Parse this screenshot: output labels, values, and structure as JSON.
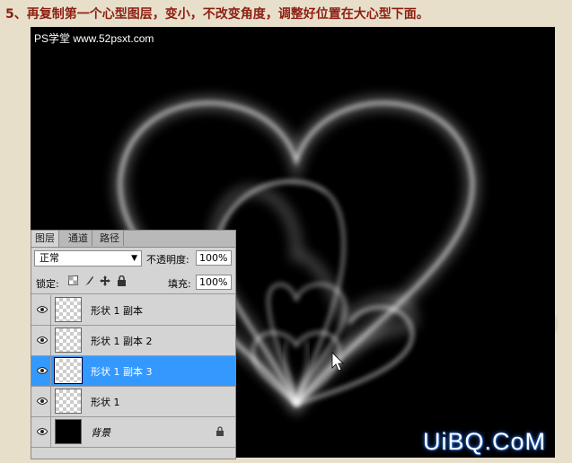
{
  "caption": "5、再复制第一个心型图层，变小，不改变角度，调整好位置在大心型下面。",
  "watermark_top": "PS学堂 www.52psxt.com",
  "watermark_bottom": "UiBQ.CoM",
  "panel": {
    "tabs": [
      "图层",
      "通道",
      "路径"
    ],
    "blend_mode": "正常",
    "opacity_label": "不透明度:",
    "opacity_value": "100%",
    "lock_label": "锁定:",
    "fill_label": "填充:",
    "fill_value": "100%",
    "layers": [
      {
        "name": "形状 1 副本",
        "selected": false
      },
      {
        "name": "形状 1 副本 2",
        "selected": false
      },
      {
        "name": "形状 1 副本 3",
        "selected": true
      },
      {
        "name": "形状 1",
        "selected": false
      },
      {
        "name": "背景",
        "selected": false
      }
    ]
  },
  "colors": {
    "caption": "#8c1f12",
    "selection": "#3399ff"
  }
}
